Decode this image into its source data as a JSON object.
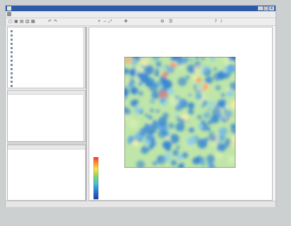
{
  "window": {
    "title": "",
    "controls": [
      "_",
      "□",
      "x"
    ]
  },
  "menubar": {
    "items": [
      "",
      "",
      "",
      "",
      "",
      "",
      "",
      "",
      ""
    ]
  },
  "left": {
    "tree_items": [
      "",
      "",
      "",
      "",
      "",
      "",
      "",
      "",
      "",
      "",
      "",
      "",
      "",
      ""
    ],
    "props_headers": [
      "",
      ""
    ],
    "props_rows": [
      {
        "k": "",
        "v": ""
      },
      {
        "k": "",
        "v": ""
      },
      {
        "k": "",
        "v": ""
      },
      {
        "k": "",
        "v": ""
      },
      {
        "k": "",
        "v": ""
      },
      {
        "k": "",
        "v": ""
      },
      {
        "k": "",
        "v": ""
      },
      {
        "k": "",
        "v": ""
      },
      {
        "k": "",
        "v": ""
      },
      {
        "k": "",
        "v": ""
      },
      {
        "k": "",
        "v": ""
      }
    ],
    "values_headers": [
      "",
      ""
    ],
    "values_rows": [
      {
        "k": "",
        "v": ""
      },
      {
        "k": "",
        "v": ""
      },
      {
        "k": "",
        "v": ""
      },
      {
        "k": "",
        "v": ""
      },
      {
        "k": "",
        "v": ""
      },
      {
        "k": "",
        "v": ""
      },
      {
        "k": "",
        "v": ""
      },
      {
        "k": "",
        "v": ""
      },
      {
        "k": "",
        "v": ""
      }
    ]
  },
  "doc": {
    "tab_label": "",
    "corner_tl": "",
    "corner_br": "",
    "info": [
      "",
      "",
      ""
    ],
    "legend_labels": [
      "",
      "",
      "",
      "",
      "",
      "",
      "",
      "",
      "",
      "",
      ""
    ],
    "colors": {
      "low": "#2f7fd8",
      "mid": "#bfe6a8",
      "high": "#ff8b5e"
    }
  },
  "status": {
    "text": ""
  }
}
